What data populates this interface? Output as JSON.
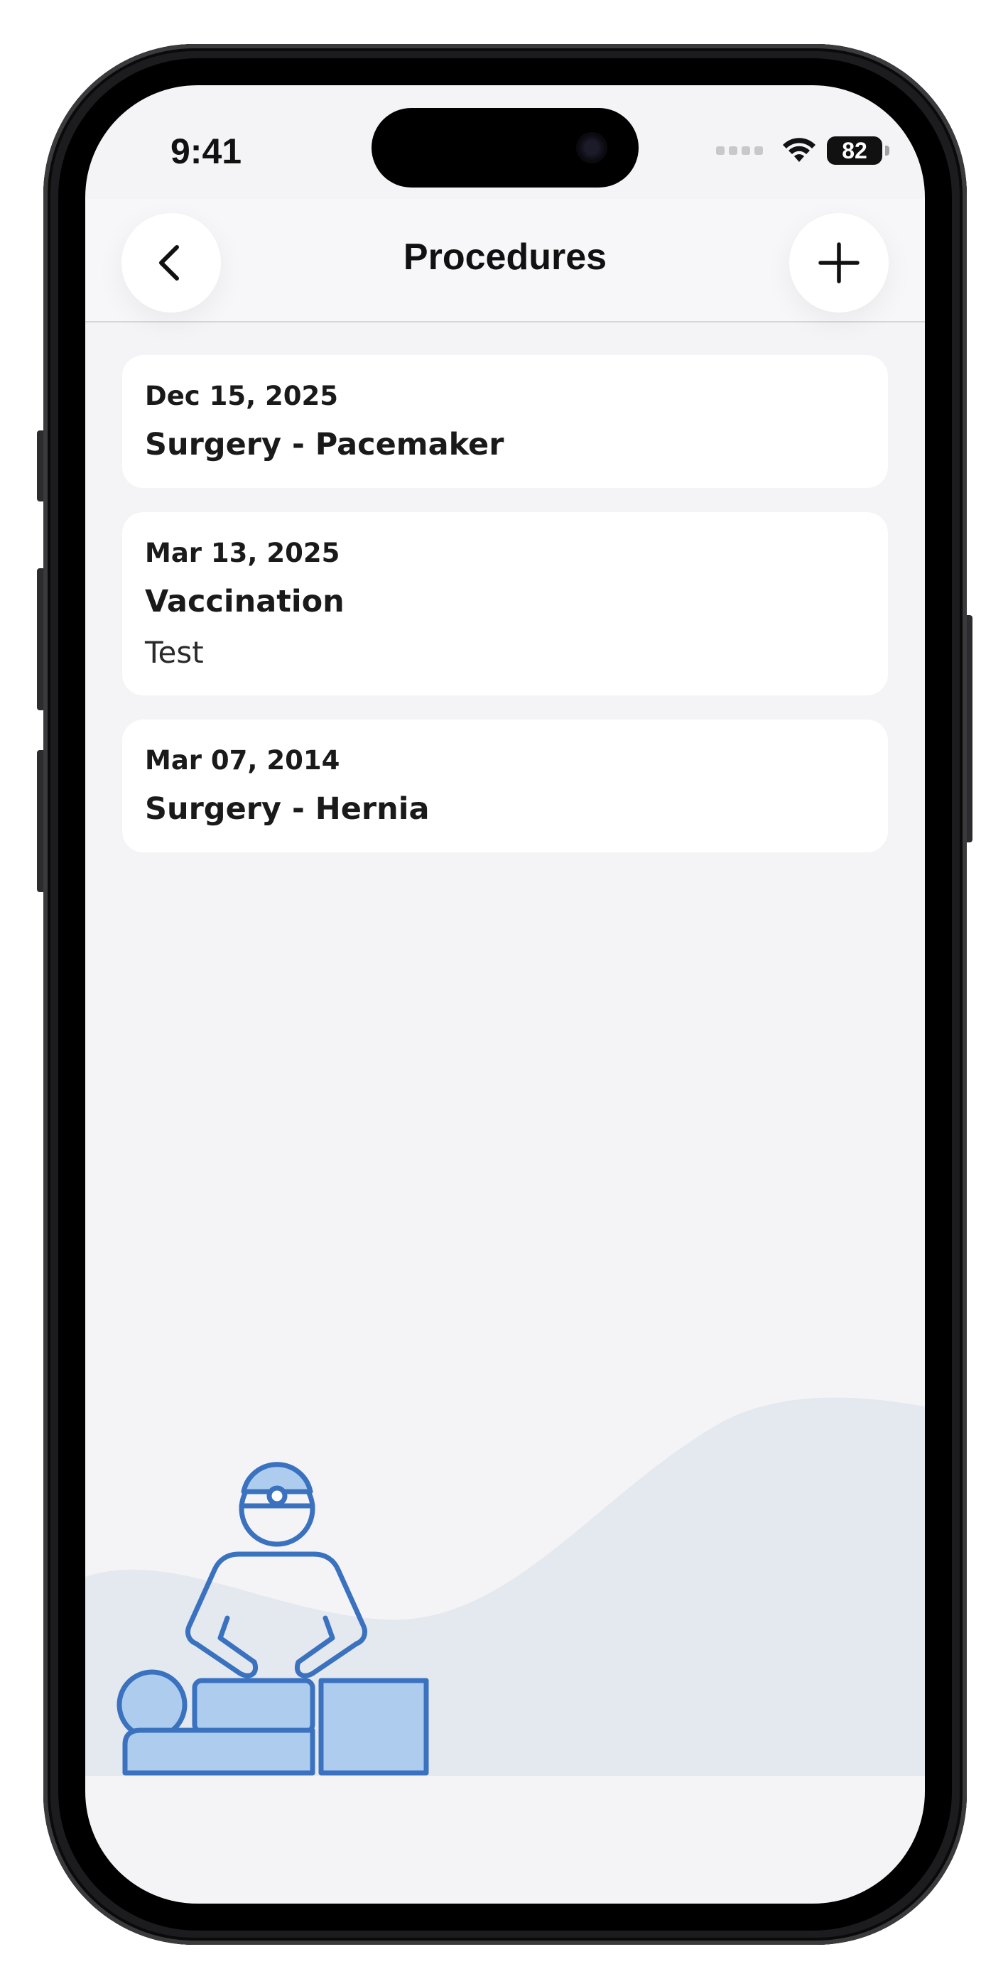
{
  "status_bar": {
    "time": "9:41",
    "battery": "82"
  },
  "nav": {
    "title": "Procedures",
    "back_icon": "chevron-left-icon",
    "add_icon": "plus-icon"
  },
  "procedures": [
    {
      "date": "Dec 15, 2025",
      "name": "Surgery - Pacemaker",
      "note": ""
    },
    {
      "date": "Mar 13, 2025",
      "name": "Vaccination",
      "note": "Test"
    },
    {
      "date": "Mar 07, 2014",
      "name": "Surgery - Hernia",
      "note": ""
    }
  ],
  "colors": {
    "accent": "#3a72bf",
    "accent_fill": "#aecdee",
    "background": "#f4f4f7",
    "wave": "#e4e8ef"
  },
  "illustration_icon": "surgeon-operating-icon"
}
